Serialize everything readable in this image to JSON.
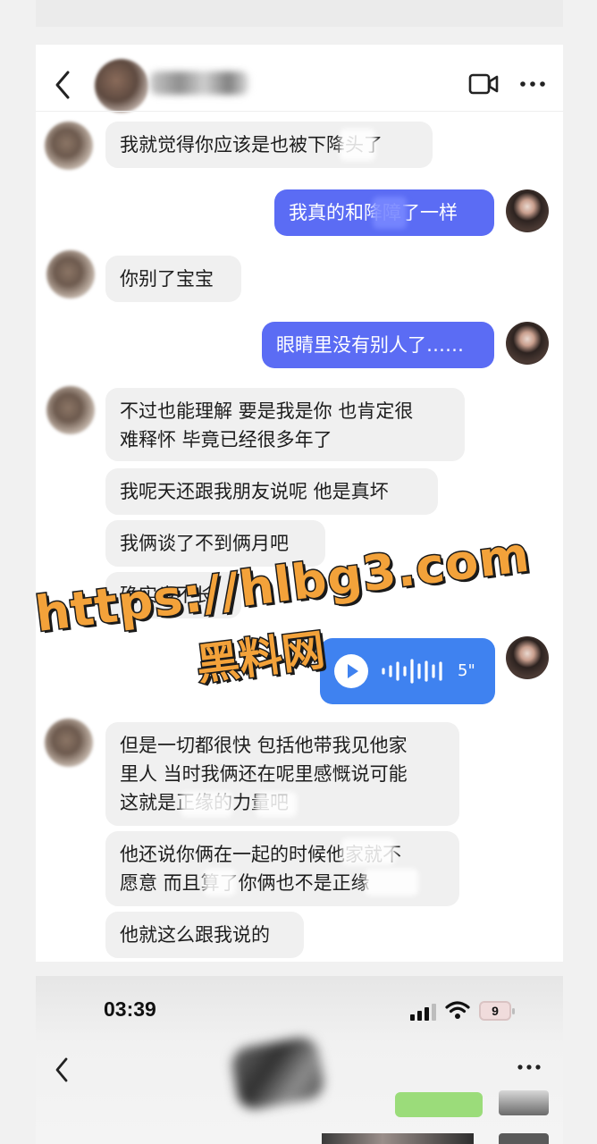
{
  "header": {
    "back_icon": "chevron-left-icon",
    "video_icon": "video-camera-icon",
    "more_icon": "more-dots-icon"
  },
  "messages": [
    {
      "side": "recv",
      "lines": [
        "我就觉得你应该是也被下降头了"
      ]
    },
    {
      "side": "sent",
      "lines": [
        "我真的和降障了一样"
      ]
    },
    {
      "side": "recv",
      "lines": [
        "你别了宝宝"
      ]
    },
    {
      "side": "sent",
      "lines": [
        "眼睛里没有别人了……"
      ]
    },
    {
      "side": "recv",
      "lines": [
        "不过也能理解 要是我是你 也肯定很",
        "难释怀 毕竟已经很多年了"
      ]
    },
    {
      "side": "recv",
      "lines": [
        "我呢天还跟我朋友说呢 他是真坏"
      ]
    },
    {
      "side": "recv",
      "lines": [
        "我俩谈了不到俩月吧"
      ]
    },
    {
      "side": "recv",
      "lines": [
        "确实也不长"
      ]
    },
    {
      "side": "recv",
      "lines": [
        "但是一切都很快 包括他带我见他家",
        "里人 当时我俩还在呢里感慨说可能",
        "这就是正缘的力量吧"
      ]
    },
    {
      "side": "recv",
      "lines": [
        "他还说你俩在一起的时候他家就不",
        "愿意 而且算了你俩也不是正缘"
      ]
    },
    {
      "side": "recv",
      "lines": [
        "他就这么跟我说的"
      ]
    }
  ],
  "voice_message": {
    "duration": "5\"",
    "play_icon": "play-icon",
    "wave_icon": "waveform-icon"
  },
  "watermark": {
    "url": "https://hlbg3.com",
    "name": "黑料网"
  },
  "status_bar": {
    "time": "03:39",
    "battery": "9",
    "signal_icon": "cellular-signal-icon",
    "wifi_icon": "wifi-icon"
  },
  "second_header": {
    "back_icon": "chevron-left-icon",
    "more_icon": "more-dots-icon"
  }
}
